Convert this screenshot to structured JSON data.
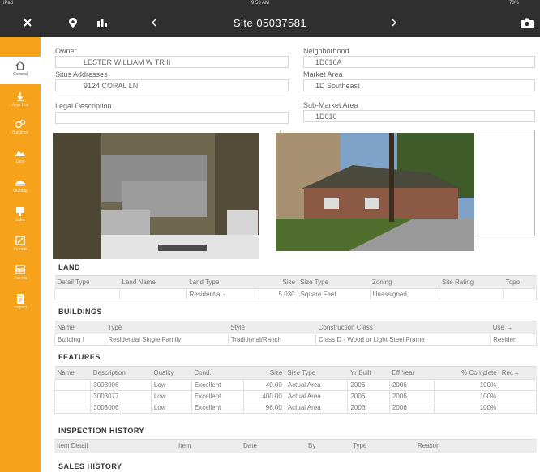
{
  "status_bar": {
    "left": "iPad",
    "time": "9:53 AM",
    "right": "73%"
  },
  "top_bar": {
    "title": "Site 05037581"
  },
  "sidebar": {
    "items": [
      {
        "label": "General",
        "icon": "home-icon",
        "active": true
      },
      {
        "label": "Appr Hist",
        "icon": "appraisal-history-icon",
        "active": false
      },
      {
        "label": "Buildings",
        "icon": "buildings-icon",
        "active": false
      },
      {
        "label": "Land",
        "icon": "land-icon",
        "active": false
      },
      {
        "label": "Outbldg",
        "icon": "outbuilding-icon",
        "active": false
      },
      {
        "label": "Sales",
        "icon": "sales-icon",
        "active": false
      },
      {
        "label": "Permits",
        "icon": "permits-icon",
        "active": false
      },
      {
        "label": "Parcels",
        "icon": "parcels-icon",
        "active": false
      },
      {
        "label": "Inspect",
        "icon": "inspect-icon",
        "active": false
      }
    ]
  },
  "general": {
    "owner_label": "Owner",
    "owner_value": "LESTER WILLIAM W TR II",
    "situs_label": "Situs Addresses",
    "situs_value": "9124 CORAL LN",
    "legal_label": "Legal Description",
    "legal_value": "",
    "neighborhood_label": "Neighborhood",
    "neighborhood_value": "1D010A",
    "market_label": "Market Area",
    "market_value": "1D Southeast",
    "submarket_label": "Sub-Market Area",
    "submarket_value": "1D010"
  },
  "land": {
    "title": "LAND",
    "headers": [
      "Detail Type",
      "Land Name",
      "Land Type",
      "Size",
      "Size Type",
      "Zoning",
      "Site Rating",
      "Topo"
    ],
    "rows": [
      [
        "",
        "",
        "Residential -",
        "5,030",
        "Square Feet",
        "Unassigned",
        "",
        ""
      ]
    ]
  },
  "buildings": {
    "title": "BUILDINGS",
    "headers": [
      "Name",
      "Type",
      "Style",
      "Construction Class",
      "Use"
    ],
    "rows": [
      [
        "Building I",
        "Residential Single Family",
        "Traditional/Ranch",
        "Class D - Wood or Light Steel Frame",
        "Residen"
      ]
    ]
  },
  "features": {
    "title": "FEATURES",
    "headers": [
      "Name",
      "Description",
      "Quality",
      "Cond.",
      "Size",
      "Size Type",
      "Yr Built",
      "Eff Year",
      "% Complete",
      "Rec"
    ],
    "rows": [
      [
        "",
        "3003006",
        "Low",
        "Excellent",
        "40.00",
        "Actual Area",
        "2006",
        "2006",
        "100%",
        ""
      ],
      [
        "",
        "3003077",
        "Low",
        "Excellent",
        "400.00",
        "Actual Area",
        "2006",
        "2006",
        "100%",
        ""
      ],
      [
        "",
        "3003006",
        "Low",
        "Excellent",
        "96.00",
        "Actual Area",
        "2006",
        "2006",
        "100%",
        ""
      ]
    ]
  },
  "inspection": {
    "title": "INSPECTION HISTORY",
    "headers": [
      "Item Detail",
      "Item",
      "Date",
      "By",
      "Type",
      "Reason"
    ]
  },
  "sales": {
    "title": "SALES HISTORY"
  },
  "colors": {
    "accent": "#f7a21b",
    "topbar": "#2f2f2f"
  }
}
